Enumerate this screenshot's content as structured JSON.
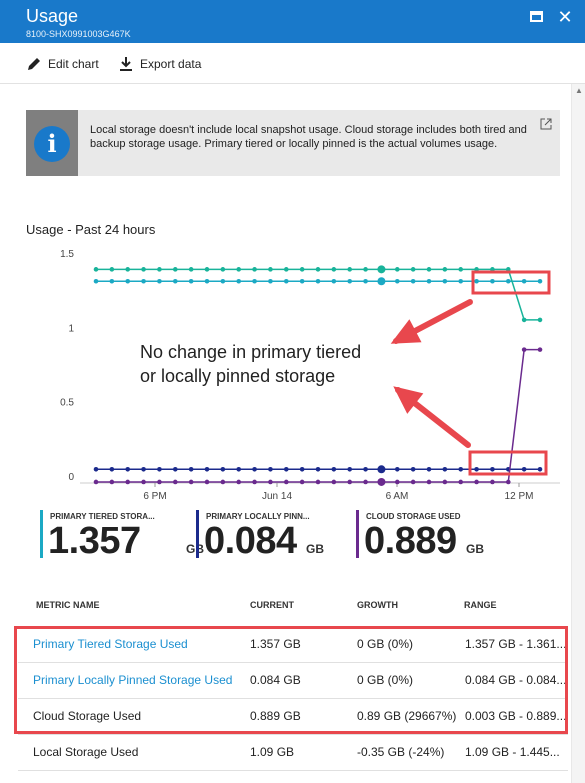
{
  "window": {
    "title": "Usage",
    "subtitle": "8100-SHX0991003G467K"
  },
  "toolbar": {
    "edit_label": "Edit chart",
    "export_label": "Export data"
  },
  "info": {
    "text": "Local storage doesn't include local snapshot usage.  Cloud storage includes both tired and backup storage usage. Primary tiered or locally pinned is the actual volumes usage."
  },
  "chart_title": "Usage - Past 24 hours",
  "callout": {
    "line1": "No change in primary tiered",
    "line2": "or locally pinned storage"
  },
  "chart_data": {
    "type": "line",
    "x_ticks": [
      "6 PM",
      "Jun 14",
      "6 AM",
      "12 PM"
    ],
    "y_ticks": [
      "1.5",
      "1",
      "0.5",
      "0"
    ],
    "ylim": [
      0,
      1.5
    ],
    "series": [
      {
        "name": "PRIMARY TIERED STORA...",
        "color": "#1ba9c4",
        "values": [
          1.31,
          1.31,
          1.31,
          1.31,
          1.31,
          1.31,
          1.31,
          1.31,
          1.31,
          1.31,
          1.31,
          1.31,
          1.31,
          1.31,
          1.31,
          1.31,
          1.31,
          1.31,
          1.31,
          1.31,
          1.31,
          1.31,
          1.31,
          1.31,
          1.31,
          1.31,
          1.31,
          1.31,
          1.31
        ]
      },
      {
        "name": "",
        "color": "#18b39a",
        "values": [
          1.39,
          1.39,
          1.39,
          1.39,
          1.39,
          1.39,
          1.39,
          1.39,
          1.39,
          1.39,
          1.39,
          1.39,
          1.39,
          1.39,
          1.39,
          1.39,
          1.39,
          1.39,
          1.39,
          1.39,
          1.39,
          1.39,
          1.39,
          1.39,
          1.39,
          1.39,
          1.39,
          1.05,
          1.05
        ]
      },
      {
        "name": "PRIMARY LOCALLY PINN...",
        "color": "#1b2a8c",
        "values": [
          0.045,
          0.045,
          0.045,
          0.045,
          0.045,
          0.045,
          0.045,
          0.045,
          0.045,
          0.045,
          0.045,
          0.045,
          0.045,
          0.045,
          0.045,
          0.045,
          0.045,
          0.045,
          0.045,
          0.045,
          0.045,
          0.045,
          0.045,
          0.045,
          0.045,
          0.045,
          0.045,
          0.045,
          0.045
        ]
      },
      {
        "name": "CLOUD STORAGE USED",
        "color": "#6a2a8e",
        "values": [
          -0.04,
          -0.04,
          -0.04,
          -0.04,
          -0.04,
          -0.04,
          -0.04,
          -0.04,
          -0.04,
          -0.04,
          -0.04,
          -0.04,
          -0.04,
          -0.04,
          -0.04,
          -0.04,
          -0.04,
          -0.04,
          -0.04,
          -0.04,
          -0.04,
          -0.04,
          -0.04,
          -0.04,
          -0.04,
          -0.04,
          -0.04,
          0.85,
          0.85
        ]
      }
    ]
  },
  "tiles": [
    {
      "label": "PRIMARY TIERED STORA...",
      "value": "1.357",
      "unit": "GB",
      "color": "#1ba9c4"
    },
    {
      "label": "PRIMARY LOCALLY PINN...",
      "value": "0.084",
      "unit": "GB",
      "color": "#1b2a8c"
    },
    {
      "label": "CLOUD STORAGE USED",
      "value": "0.889",
      "unit": "GB",
      "color": "#6a2a8e"
    }
  ],
  "table": {
    "headers": [
      "METRIC NAME",
      "CURRENT",
      "GROWTH",
      "RANGE"
    ],
    "rows": [
      {
        "name": "Primary Tiered Storage Used",
        "current": "1.357 GB",
        "growth": "0 GB (0%)",
        "range": "1.357 GB - 1.361..."
      },
      {
        "name": "Primary Locally Pinned Storage Used",
        "current": "0.084 GB",
        "growth": "0 GB (0%)",
        "range": "0.084 GB - 0.084..."
      },
      {
        "name": "Cloud Storage Used",
        "current": "0.889 GB",
        "growth": "0.89 GB (29667%)",
        "range": "0.003 GB - 0.889..."
      },
      {
        "name": "Local Storage Used",
        "current": "1.09 GB",
        "growth": "-0.35 GB (-24%)",
        "range": "1.09 GB - 1.445..."
      }
    ]
  },
  "colors": {
    "titlebar": "#1979ca",
    "highlight": "#e8474d",
    "link": "#1b8fd0"
  }
}
